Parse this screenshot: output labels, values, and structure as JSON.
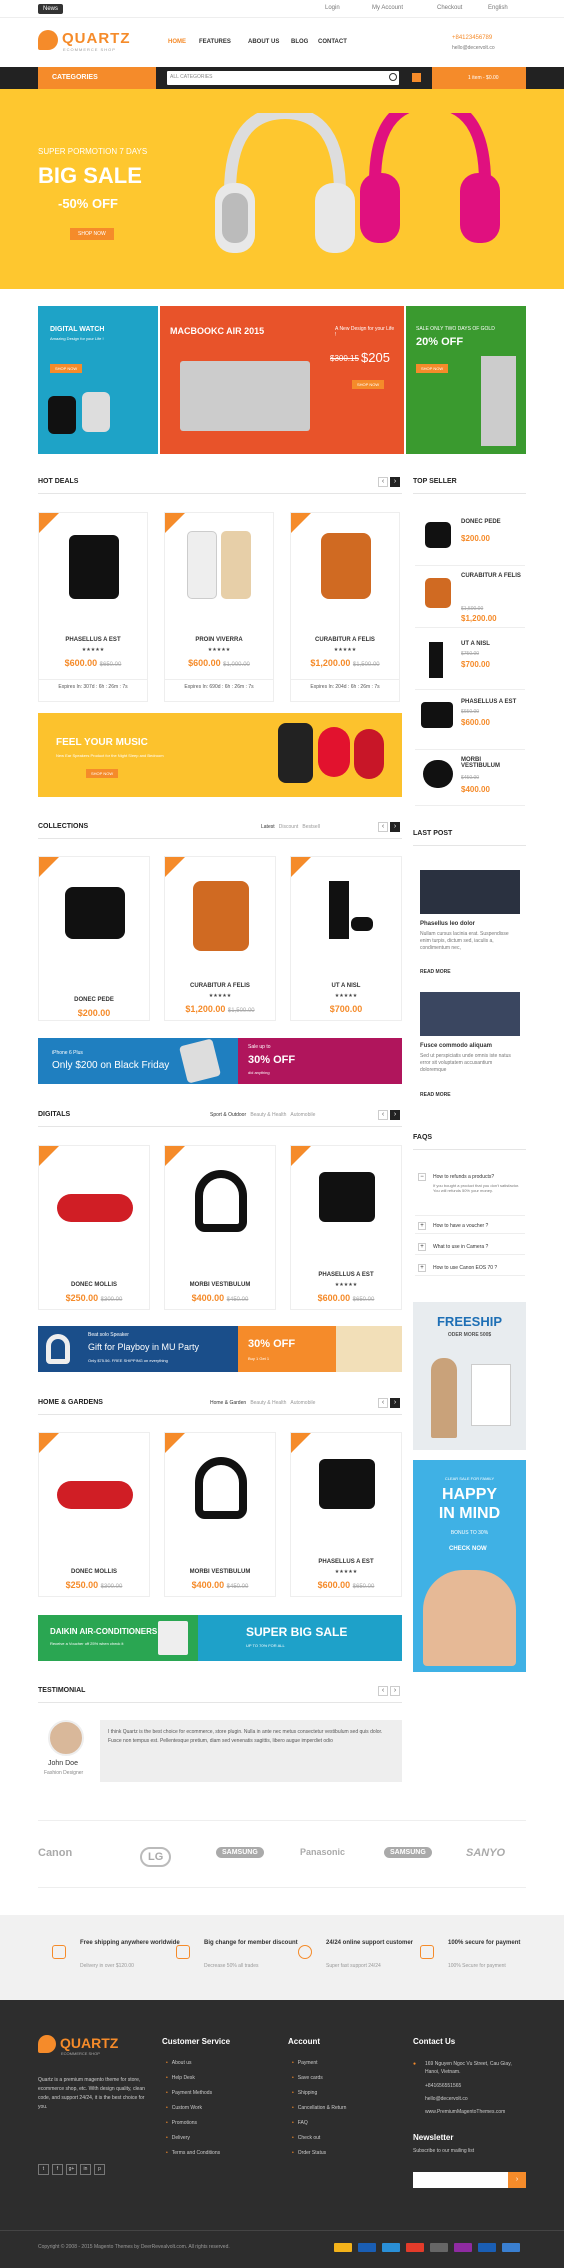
{
  "topbar": {
    "news": "News",
    "login": "Login",
    "account": "My Account",
    "checkout": "Checkout",
    "language": "English"
  },
  "header": {
    "logo": "QUARTZ",
    "logo_sub": "ECOMMERCE SHOP",
    "nav": [
      "HOME",
      "FEATURES",
      "ABOUT US",
      "BLOG",
      "CONTACT"
    ],
    "phone": "+84123456789",
    "email": "hello@decervolt.co"
  },
  "search": {
    "categories": "CATEGORIES",
    "select": "ALL CATEGORIES",
    "cart": "1 item - $0.00"
  },
  "hero": {
    "line1": "SUPER PORMOTION 7 DAYS",
    "line2": "BIG SALE",
    "line3": "-50% OFF",
    "button": "SHOP NOW"
  },
  "promos": [
    {
      "title": "DIGITAL WATCH",
      "sub": "Amazing Design for your Life !",
      "btn": "SHOP NOW"
    },
    {
      "title": "MACBOOKC AIR 2015",
      "sub": "A New Design for your Life !",
      "old": "$300.15",
      "price": "$205",
      "btn": "SHOP NOW"
    },
    {
      "title": "SALE ONLY TWO DAYS OF GOLD",
      "sub": "20% OFF",
      "btn": "SHOP NOW"
    }
  ],
  "hot_deals": {
    "title": "HOT DEALS",
    "items": [
      {
        "name": "PHASELLUS A EST",
        "price": "$600.00",
        "old": "$650.00",
        "exp": "Expires In: 307d : 6h : 26m : 7s"
      },
      {
        "name": "PROIN VIVERRA",
        "price": "$600.00",
        "old": "$1,000.00",
        "exp": "Expires In: 690d : 6h : 26m : 7s"
      },
      {
        "name": "CURABITUR A FELIS",
        "price": "$1,200.00",
        "old": "$1,500.00",
        "exp": "Expires In: 204d : 6h : 26m : 7s"
      }
    ]
  },
  "top_seller": {
    "title": "TOP SELLER",
    "items": [
      {
        "name": "DONEC PEDE",
        "price": "$200.00",
        "old": ""
      },
      {
        "name": "CURABITUR A FELIS",
        "price": "$1,200.00",
        "old": "$1,500.00"
      },
      {
        "name": "UT A NISL",
        "price": "$700.00",
        "old": "$750.00"
      },
      {
        "name": "PHASELLUS A EST",
        "price": "$600.00",
        "old": "$650.00"
      },
      {
        "name": "MORBI VESTIBULUM",
        "price": "$400.00",
        "old": "$450.00"
      }
    ]
  },
  "music": {
    "title": "FEEL YOUR MUSIC",
    "sub": "New Ear Speakers Product for the Night Sleep and Bedroom",
    "btn": "SHOP NOW"
  },
  "collections": {
    "title": "COLLECTIONS",
    "tabs": [
      "Latest",
      "Discount",
      "Bestsell"
    ],
    "items": [
      {
        "name": "DONEC PEDE",
        "price": "$200.00",
        "old": ""
      },
      {
        "name": "CURABITUR A FELIS",
        "price": "$1,200.00",
        "old": "$1,500.00"
      },
      {
        "name": "UT A NISL",
        "price": "$700.00",
        "old": "$750.00"
      }
    ]
  },
  "iphone": {
    "model": "iPhone 6 Plus",
    "line": "Only $200 on Black Friday",
    "sale": "Sale up to",
    "pct": "30% OFF",
    "tag": "did anything"
  },
  "last_post": {
    "title": "LAST POST",
    "posts": [
      {
        "title": "Phasellus leo dolor",
        "text": "Nullam cursus lacinia erat. Suspendisse enim turpis, dictum sed, iaculis a, condimentum nec,",
        "more": "READ MORE"
      },
      {
        "title": "Fusce commodo aliquam",
        "text": "Sed ut perspiciatis unde omnis iste natus error sit voluptatem accusantium doloremque",
        "more": "READ MORE"
      }
    ]
  },
  "digitals": {
    "title": "DIGITALS",
    "tabs": [
      "Sport & Outdoor",
      "Beauty & Health",
      "Automobile"
    ],
    "items": [
      {
        "name": "DONEC MOLLIS",
        "price": "$250.00",
        "old": "$300.00"
      },
      {
        "name": "MORBI VESTIBULUM",
        "price": "$400.00",
        "old": "$450.00"
      },
      {
        "name": "PHASELLUS A EST",
        "price": "$600.00",
        "old": "$650.00"
      }
    ]
  },
  "faqs": {
    "title": "FAQS",
    "items": [
      {
        "q": "How to refunds a products?",
        "a": "If you bought a product that you don't satisfactor. You will refunds 50% your money."
      },
      {
        "q": "How to have a voucher ?"
      },
      {
        "q": "What to use in Camera ?"
      },
      {
        "q": "How to use Canon EOS 70 ?"
      }
    ]
  },
  "playboy": {
    "l1": "Beat solo Speaker",
    "l2": "Gift for Playboy in MU Party",
    "l3": "Only $75.56. FREE SHIPPING on everything",
    "pct": "30% OFF",
    "sub": "Buy 1 Get 1"
  },
  "home_gardens": {
    "title": "HOME & GARDENS",
    "tabs": [
      "Home & Garden",
      "Beauty & Health",
      "Automobile"
    ],
    "items": [
      {
        "name": "DONEC MOLLIS",
        "price": "$250.00",
        "old": "$300.00"
      },
      {
        "name": "MORBI VESTIBULUM",
        "price": "$400.00",
        "old": "$450.00"
      },
      {
        "name": "PHASELLUS A EST",
        "price": "$600.00",
        "old": "$650.00"
      }
    ]
  },
  "freeship": {
    "title": "FREESHIP",
    "sub": "ODER MORE 500$"
  },
  "happy": {
    "top": "CLEAR SALE FOR FAMILY",
    "l1": "HAPPY",
    "l2": "IN MIND",
    "bonus": "BONUS TO 30%",
    "btn": "CHECK NOW"
  },
  "daikin": {
    "title": "DAIKIN AIR-CONDITIONERS",
    "sub": "Receive a Voucher off 25% when check it",
    "big": "SUPER BIG SALE",
    "up": "UP TO 70% FOR ALL"
  },
  "testimonial": {
    "title": "TESTIMONIAL",
    "name": "John Doe",
    "role": "Fashion Designer",
    "text": "I think Quartz is the best choice for ecommerce, store plugin. Nulla in ante nec metus consectetur vestibulum sed quis dolor. Fusce non tempus est. Pellentesque pretium, diam sed venenatis sagittis, libero augue imperdiet odio"
  },
  "brands": [
    "Canon",
    "LG",
    "SAMSUNG",
    "Panasonic",
    "SAMSUNG",
    "SANYO"
  ],
  "features": [
    {
      "title": "Free shipping anywhere worldwide",
      "sub": "Delivery in over $120.00"
    },
    {
      "title": "Big change for member discount",
      "sub": "Decrease 50% all trades"
    },
    {
      "title": "24/24 online support customer",
      "sub": "Super fast support 24/24"
    },
    {
      "title": "100% secure for payment",
      "sub": "100% Secure for payment"
    }
  ],
  "footer": {
    "desc": "Quartz is a premium magento theme for store, ecommerce shop, etc. With design quality, clean code, and support 24/24, it is the best choice for you.",
    "customer_service": {
      "title": "Customer Service",
      "links": [
        "About us",
        "Help Desk",
        "Payment Methods",
        "Custom Work",
        "Promotions",
        "Delivery",
        "Terms and Conditions"
      ]
    },
    "account": {
      "title": "Account",
      "links": [
        "Payment",
        "Save cards",
        "Shipping",
        "Cancellation & Return",
        "FAQ",
        "Check out",
        "Order Status"
      ]
    },
    "contact": {
      "title": "Contact Us",
      "address": "169 Nguyen Ngoc Vu Street, Cau Giay, Hanoi, Vietnam.",
      "phone": "+841656551565",
      "email": "hello@decervolt.co",
      "web": "www.PremiumMagentoThemes.com"
    },
    "newsletter": {
      "title": "Newsletter",
      "sub": "Subscribe to our mailing list"
    },
    "social": [
      "t",
      "f",
      "g+",
      "in",
      "p"
    ],
    "copyright": "Copyright © 2008 - 2015 Magento Themes by DeerRevealvolt.com. All rights reserved."
  },
  "colors": {
    "accent": "#f58b2a",
    "hero_bg": "#fec72f",
    "footer_bg": "#2d2d2d"
  }
}
